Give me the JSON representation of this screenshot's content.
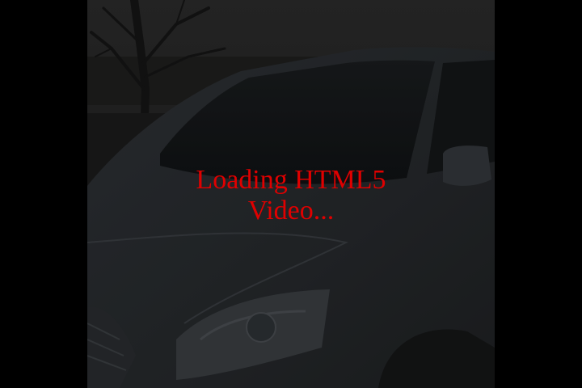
{
  "player": {
    "loading_line1": "Loading HTML5",
    "loading_line2": "Video...",
    "loading_color": "#e00000",
    "background_color": "#000000"
  },
  "poster": {
    "subject": "dark photo of a grey minivan parked near a bare tree at dusk"
  }
}
